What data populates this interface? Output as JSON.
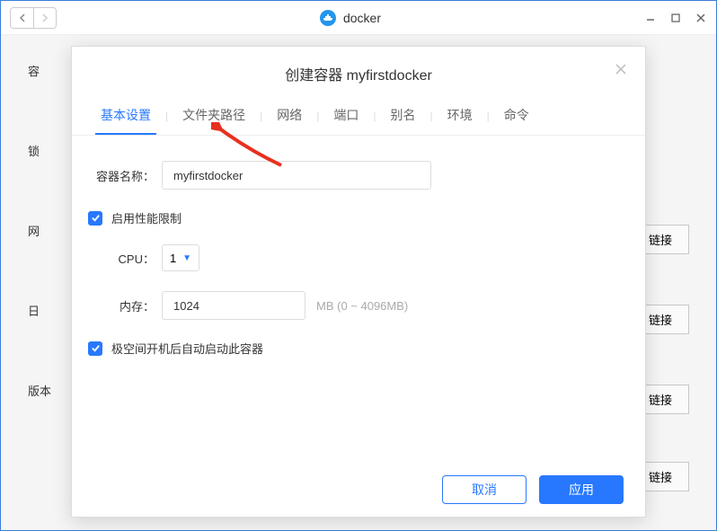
{
  "window": {
    "title": "docker"
  },
  "background": {
    "side_labels": [
      "容",
      "锁",
      "网",
      "日",
      "版本"
    ],
    "link_button": "链接"
  },
  "dialog": {
    "title_prefix": "创建容器",
    "title_name": "myfirstdocker",
    "tabs": [
      "基本设置",
      "文件夹路径",
      "网络",
      "端口",
      "别名",
      "环境",
      "命令"
    ],
    "active_tab": 0,
    "form": {
      "name_label": "容器名称：",
      "name_value": "myfirstdocker",
      "perf_limit_label": "启用性能限制",
      "perf_limit_checked": true,
      "cpu_label": "CPU：",
      "cpu_value": "1",
      "memory_label": "内存：",
      "memory_value": "1024",
      "memory_hint": "MB (0 ~ 4096MB)",
      "autostart_label": "极空间开机后自动启动此容器",
      "autostart_checked": true
    },
    "cancel": "取消",
    "apply": "应用"
  }
}
